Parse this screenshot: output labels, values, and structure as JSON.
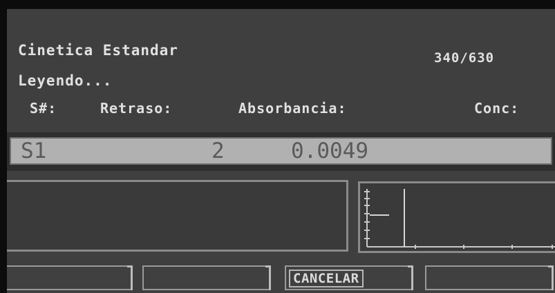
{
  "header": {
    "title": "Cinetica Estandar",
    "wavelengths": "340/630",
    "status": "Leyendo..."
  },
  "columns": [
    "S#:",
    "Retraso:",
    "Absorbancia:",
    "Conc:"
  ],
  "result_row": {
    "sample": "S1",
    "delay": "2",
    "absorbance": "0.0049",
    "conc": ""
  },
  "softkeys": [
    "",
    "",
    "CANCELAR",
    ""
  ]
}
